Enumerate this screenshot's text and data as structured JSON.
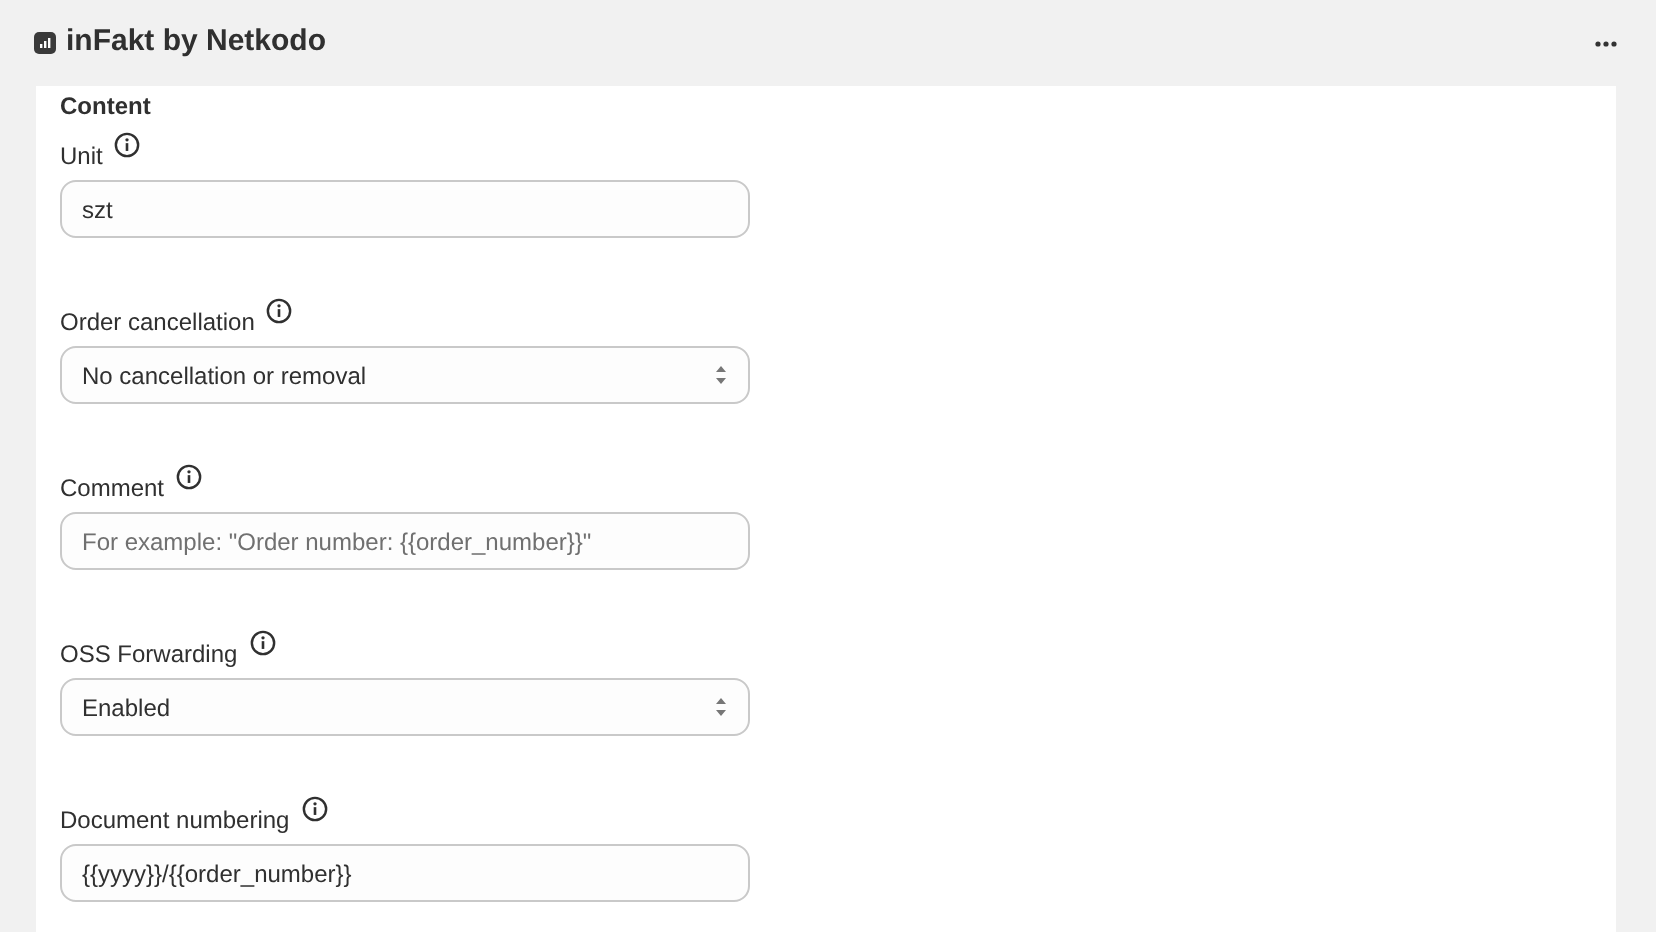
{
  "window": {
    "title": "inFakt by Netkodo"
  },
  "section": {
    "title": "Content"
  },
  "fields": [
    {
      "label": "Unit",
      "kind": "text",
      "value": "szt"
    },
    {
      "label": "Order cancellation",
      "kind": "select",
      "value": "No cancellation or removal"
    },
    {
      "label": "Comment",
      "kind": "text",
      "placeholder": "For example: \"Order number: {{order_number}}\""
    },
    {
      "label": "OSS Forwarding",
      "kind": "select",
      "value": "Enabled"
    },
    {
      "label": "Document numbering",
      "kind": "text",
      "value": "{{yyyy}}/{{order_number}}"
    }
  ]
}
